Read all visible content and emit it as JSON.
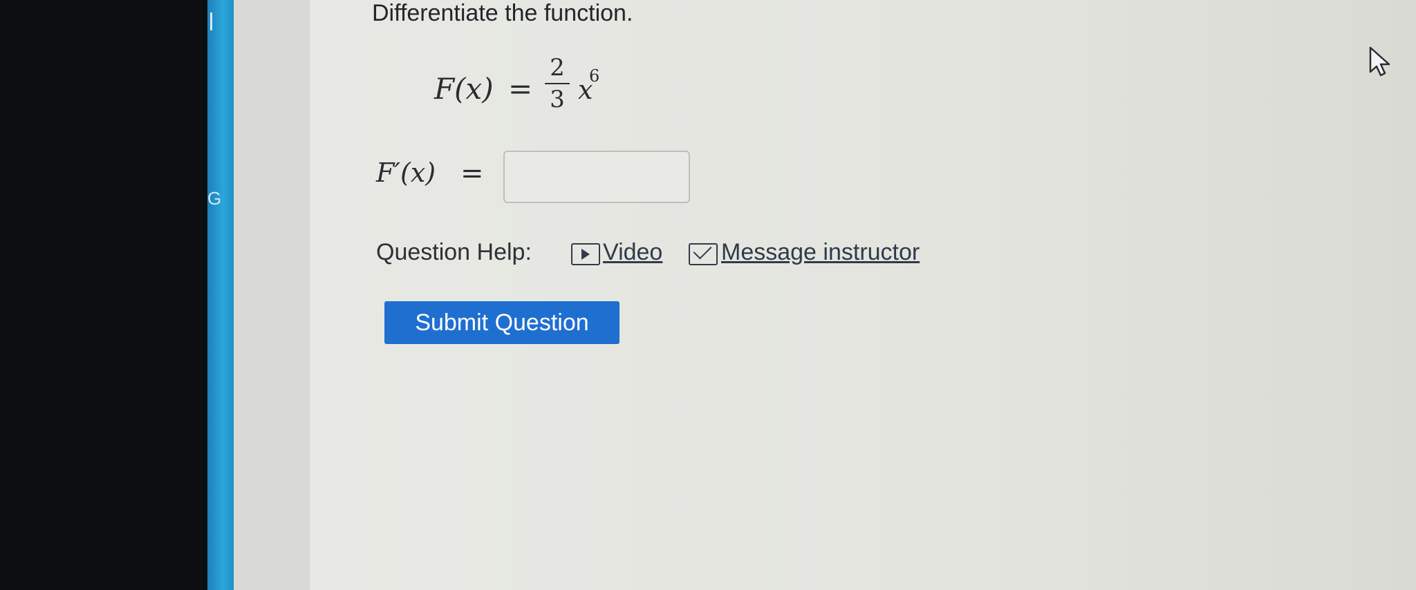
{
  "sidebar": {
    "strip_letter": "G"
  },
  "question": {
    "prompt": "Differentiate the function.",
    "function_lhs": "F(x)",
    "equals": "=",
    "fraction_numerator": "2",
    "fraction_denominator": "3",
    "variable": "x",
    "exponent": "6",
    "derivative_lhs": "F′(x)",
    "answer_value": ""
  },
  "help": {
    "label": "Question Help:",
    "video_label": "Video",
    "message_label": "Message instructor"
  },
  "actions": {
    "submit_label": "Submit Question"
  },
  "colors": {
    "submit_bg": "#1f6fd0",
    "strip_blue": "#2aa6db"
  },
  "icons": {
    "video": "play-icon",
    "message": "mail-icon",
    "pointer": "cursor-icon"
  }
}
